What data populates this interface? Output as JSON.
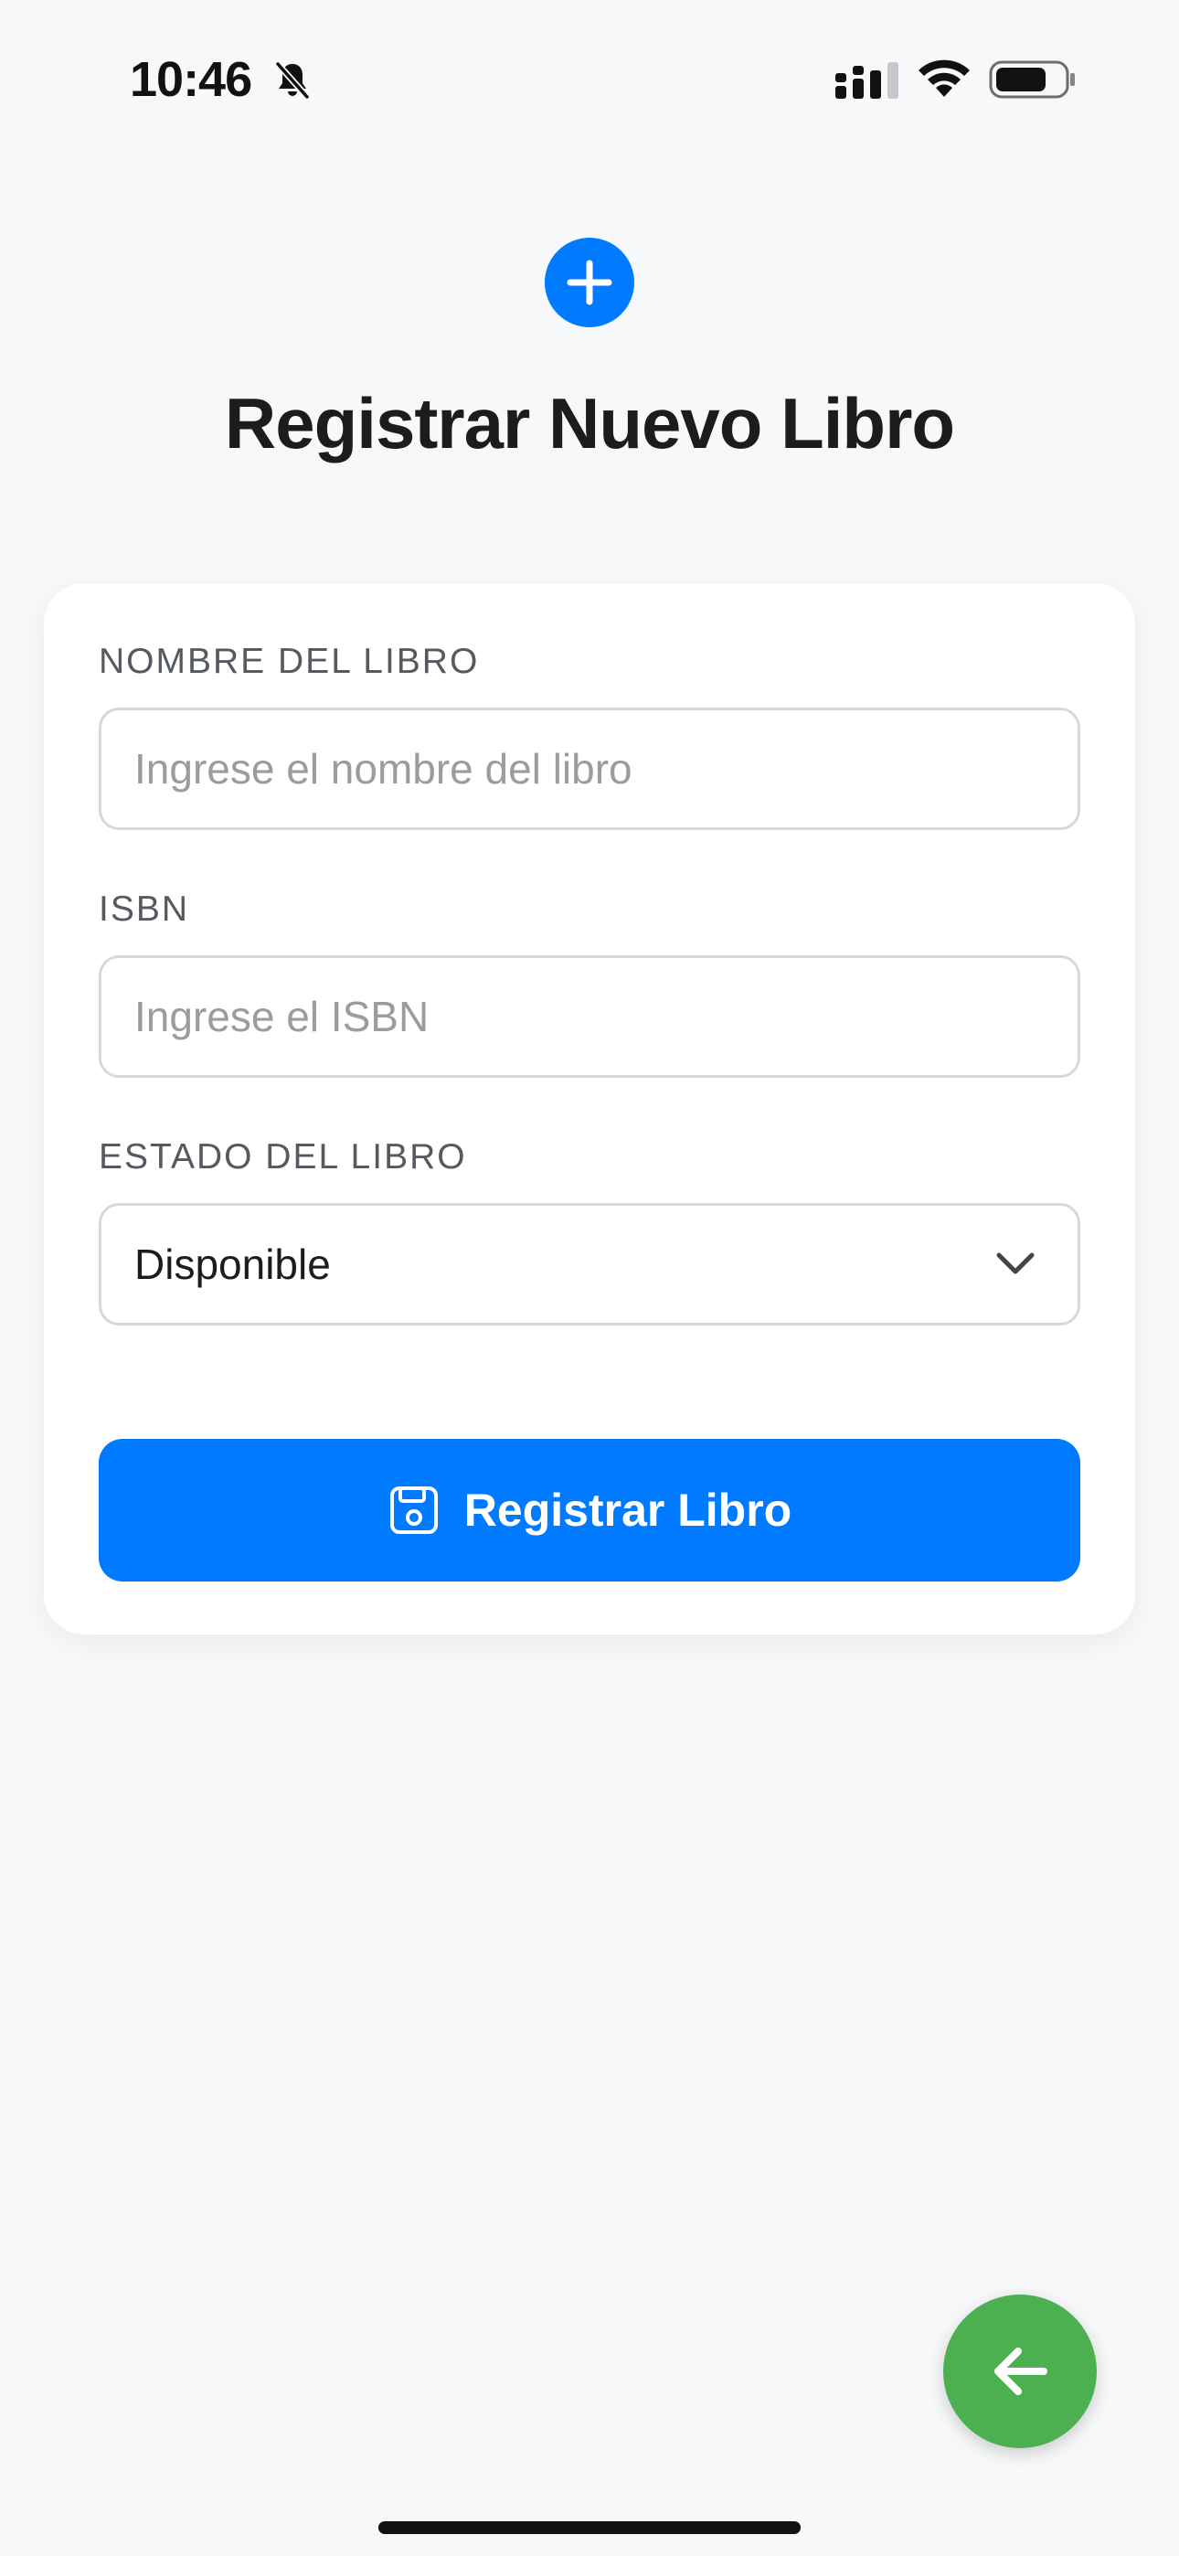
{
  "status_bar": {
    "time": "10:46",
    "icons": [
      "bell-slash-icon",
      "cellular-signal-icon",
      "wifi-icon",
      "battery-icon"
    ]
  },
  "header": {
    "icon": "plus-circle-icon",
    "title": "Registrar Nuevo Libro"
  },
  "form": {
    "fields": [
      {
        "label": "NOMBRE DEL LIBRO",
        "value": "",
        "placeholder": "Ingrese el nombre del libro"
      },
      {
        "label": "ISBN",
        "value": "",
        "placeholder": "Ingrese el ISBN"
      },
      {
        "label": "ESTADO DEL LIBRO",
        "value": "Disponible"
      }
    ],
    "submit": {
      "icon": "save-icon",
      "label": "Registrar Libro"
    }
  },
  "fab": {
    "icon": "arrow-left-icon"
  },
  "colors": {
    "background": "#f6f8fa",
    "primary": "#007aff",
    "fab": "#4caf50",
    "card": "#ffffff"
  }
}
